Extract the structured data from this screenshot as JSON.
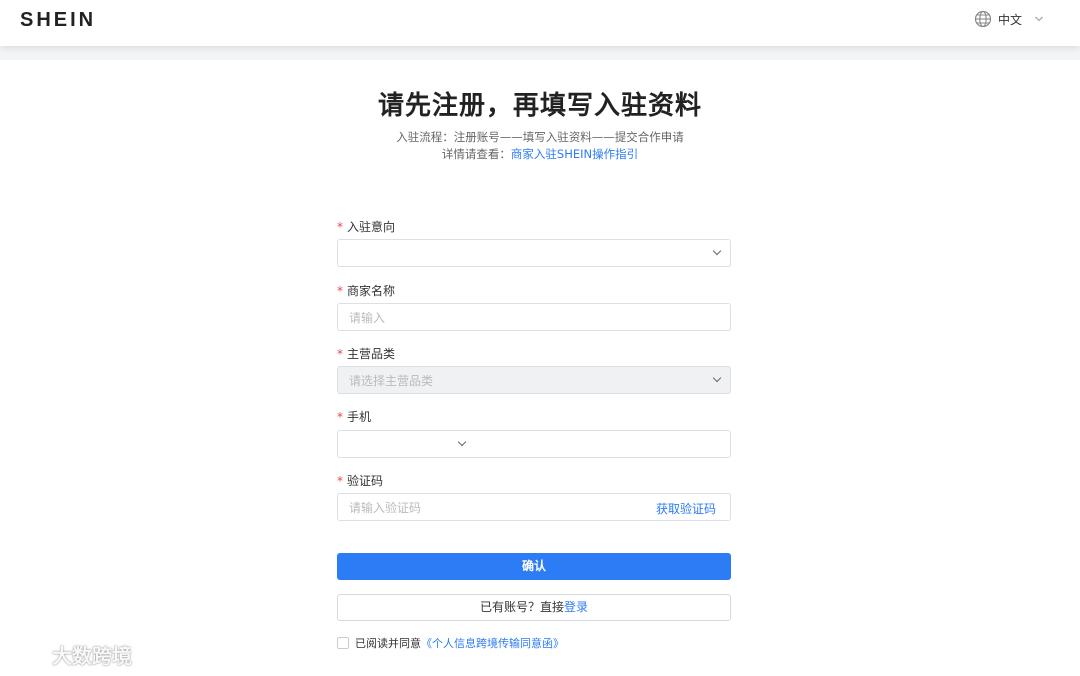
{
  "header": {
    "logo": "SHEIN",
    "language": "中文"
  },
  "main": {
    "title": "请先注册，再填写入驻资料",
    "process_text": "入驻流程：注册账号——填写入驻资料——提交合作申请",
    "detail_prefix": "详情请查看：",
    "detail_link": "商家入驻SHEIN操作指引"
  },
  "form": {
    "required_mark": "*",
    "intent": {
      "label": "入驻意向",
      "value": ""
    },
    "merchant_name": {
      "label": "商家名称",
      "placeholder": "请输入"
    },
    "category": {
      "label": "主营品类",
      "placeholder": "请选择主营品类"
    },
    "phone": {
      "label": "手机",
      "code_value": "",
      "number_value": ""
    },
    "verify": {
      "label": "验证码",
      "placeholder": "请输入验证码",
      "get_code": "获取验证码"
    }
  },
  "actions": {
    "confirm": "确认",
    "login_prefix": "已有账号？直接",
    "login_link": "登录"
  },
  "agreement": {
    "text": "已阅读并同意",
    "link": "《个人信息跨境传输同意函》"
  },
  "watermark": {
    "text": "大数跨境"
  }
}
